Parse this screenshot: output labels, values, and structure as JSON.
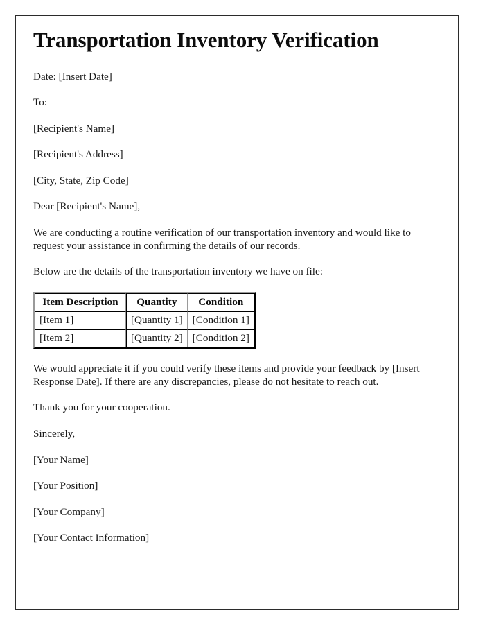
{
  "document": {
    "title": "Transportation Inventory Verification",
    "date_line": "Date: [Insert Date]",
    "to_label": "To:",
    "recipient_name": "[Recipient's Name]",
    "recipient_address": "[Recipient's Address]",
    "recipient_city_state_zip": "[City, State, Zip Code]",
    "salutation": "Dear [Recipient's Name],",
    "intro_paragraph": "We are conducting a routine verification of our transportation inventory and would like to request your assistance in confirming the details of our records.",
    "table_lead_in": "Below are the details of the transportation inventory we have on file:",
    "closing_request": "We would appreciate it if you could verify these items and provide your feedback by [Insert Response Date]. If there are any discrepancies, please do not hesitate to reach out.",
    "thanks": "Thank you for your cooperation.",
    "sign_off": "Sincerely,",
    "signature": {
      "name": "[Your Name]",
      "position": "[Your Position]",
      "company": "[Your Company]",
      "contact": "[Your Contact Information]"
    }
  },
  "inventory_table": {
    "headers": {
      "item": "Item Description",
      "quantity": "Quantity",
      "condition": "Condition"
    },
    "rows": [
      {
        "item": "[Item 1]",
        "quantity": "[Quantity 1]",
        "condition": "[Condition 1]"
      },
      {
        "item": "[Item 2]",
        "quantity": "[Quantity 2]",
        "condition": "[Condition 2]"
      }
    ]
  },
  "colors": {
    "page_background": "#ffffff",
    "border": "#2b2b2b",
    "text": "#1a1a1a",
    "heading": "#0d0d0d"
  }
}
